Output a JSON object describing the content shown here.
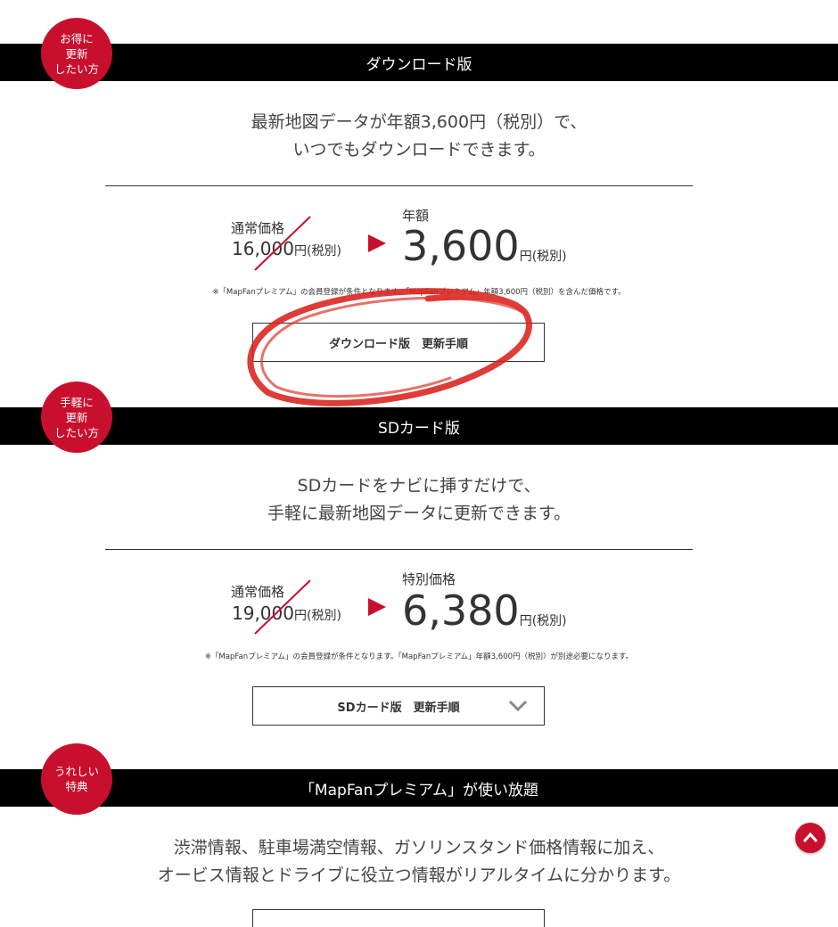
{
  "sections": [
    {
      "badge": [
        "お得に",
        "更新",
        "したい方"
      ],
      "title": "ダウンロード版",
      "lead": [
        "最新地図データが年額3,600円（税別）で、",
        "いつでもダウンロードできます。"
      ],
      "normal_label": "通常価格",
      "old_price": "16,000",
      "old_unit": "円(税別)",
      "new_label": "年額",
      "new_price": "3,600",
      "new_unit": "円(税別)",
      "note": "※「MapFanプレミアム」の会員登録が条件となります。「MapFanプレミアム」年額3,600円（税別）を含んだ価格です。",
      "button": "ダウンロード版　更新手順"
    },
    {
      "badge": [
        "手軽に",
        "更新",
        "したい方"
      ],
      "title": "SDカード版",
      "lead": [
        "SDカードをナビに挿すだけで、",
        "手軽に最新地図データに更新できます。"
      ],
      "normal_label": "通常価格",
      "old_price": "19,000",
      "old_unit": "円(税別)",
      "new_label": "特別価格",
      "new_price": "6,380",
      "new_unit": "円(税別)",
      "note": "※「MapFanプレミアム」の会員登録が条件となります。「MapFanプレミアム」年額3,600円（税別）が別途必要になります。",
      "button": "SDカード版　更新手順"
    },
    {
      "badge": [
        "うれしい",
        "特典"
      ],
      "title": "「MapFanプレミアム」が使い放題",
      "lead": [
        "渋滞情報、駐車場満空情報、ガソリンスタンド価格情報に加え、",
        "オービス情報とドライブに役立つ情報がリアルタイムに分かります。"
      ]
    }
  ],
  "icons": {
    "arrow": "red-triangle-right-icon",
    "chevron": "chevron-down-icon",
    "back_to_top": "chevron-up-icon"
  },
  "colors": {
    "accent": "#c8102e",
    "band": "#000000"
  }
}
